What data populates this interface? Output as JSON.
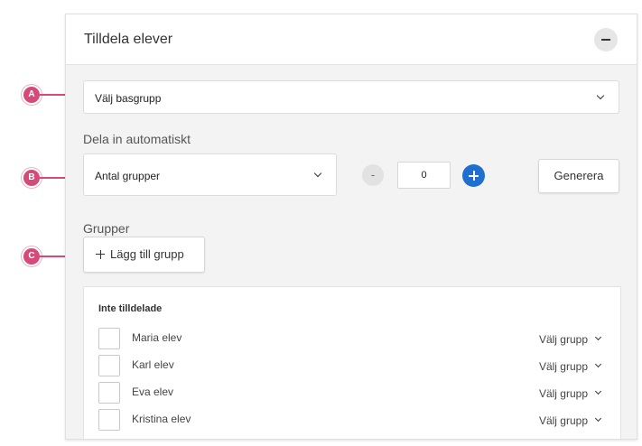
{
  "panel": {
    "title": "Tilldela elever",
    "collapse_icon": "minus-icon"
  },
  "basgrupp_select": {
    "value": "Välj basgrupp"
  },
  "auto_split": {
    "label": "Dela in automatiskt",
    "mode_select": {
      "value": "Antal grupper"
    },
    "decrement_label": "-",
    "count_value": "0",
    "increment_icon": "plus-icon",
    "generate_label": "Generera"
  },
  "groups": {
    "label": "Grupper",
    "add_group_label": "Lägg till grupp"
  },
  "unassigned": {
    "title": "Inte tilldelade",
    "students": [
      {
        "name": "Maria elev",
        "group_select": "Välj grupp"
      },
      {
        "name": "Karl elev",
        "group_select": "Välj grupp"
      },
      {
        "name": "Eva elev",
        "group_select": "Välj grupp"
      },
      {
        "name": "Kristina elev",
        "group_select": "Välj grupp"
      }
    ]
  },
  "callouts": [
    "A",
    "B",
    "C"
  ],
  "colors": {
    "accent": "#1f6fd1",
    "callout": "#d64a7a"
  }
}
